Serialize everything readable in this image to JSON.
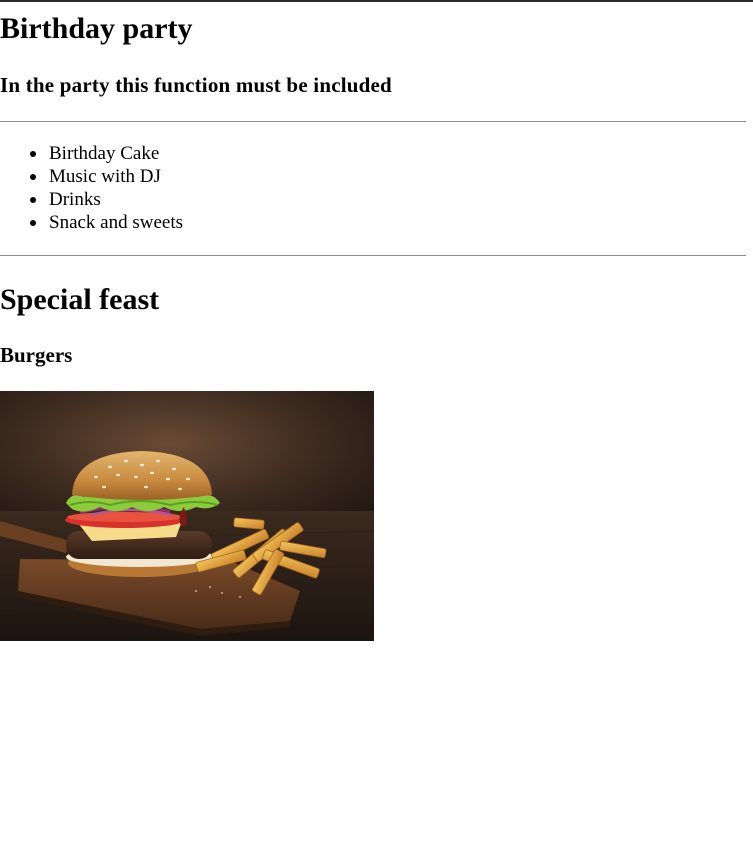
{
  "page": {
    "title": "Birthday party",
    "subtitle": "In the party this function must be included",
    "items": [
      "Birthday Cake",
      "Music with DJ",
      "Drinks",
      "Snack and sweets"
    ],
    "section_title": "Special feast",
    "section_subtitle": "Burgers",
    "image": {
      "depicts": "burger-with-fries-photo"
    }
  }
}
